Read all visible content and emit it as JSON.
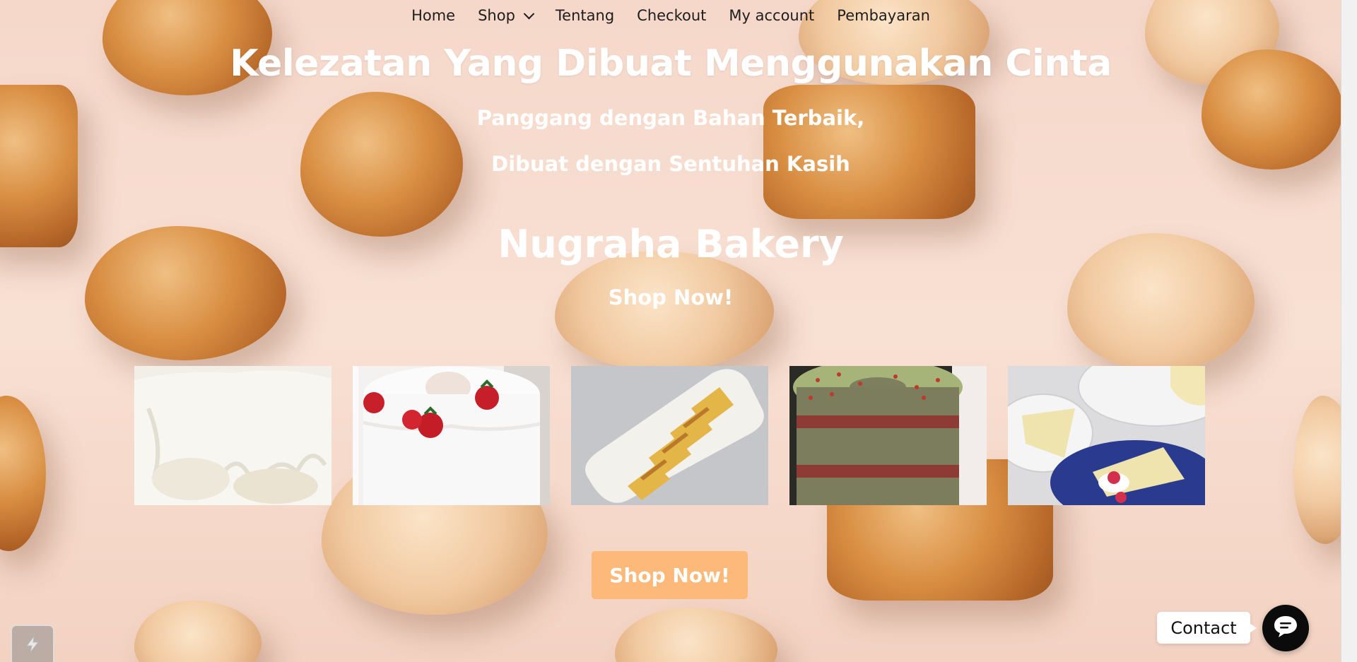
{
  "nav": {
    "items": [
      {
        "label": "Home"
      },
      {
        "label": "Shop",
        "has_dropdown": true
      },
      {
        "label": "Tentang"
      },
      {
        "label": "Checkout"
      },
      {
        "label": "My account"
      },
      {
        "label": "Pembayaran"
      }
    ]
  },
  "hero": {
    "headline": "Kelezatan Yang Dibuat Menggunakan Cinta",
    "sub_line_1": "Panggang dengan Bahan Terbaik,",
    "sub_line_2": "Dibuat dengan Sentuhan Kasih",
    "brand": "Nugraha Bakery",
    "shop_link": "Shop Now!"
  },
  "gallery": {
    "items": [
      {
        "name": "white-glazed-cake-image"
      },
      {
        "name": "strawberry-chiffon-cake-image"
      },
      {
        "name": "sponge-cake-slices-image"
      },
      {
        "name": "pandan-red-velvet-cake-image"
      },
      {
        "name": "chiffon-cake-plates-image"
      }
    ]
  },
  "cta": {
    "label": "Shop Now!"
  },
  "contact": {
    "label": "Contact",
    "icon": "chat-bubble-icon"
  },
  "colors": {
    "cta_background": "#fdb97a",
    "hero_text": "#ffffff",
    "nav_text": "#1d1d1d",
    "contact_button": "#0b0b0b"
  }
}
